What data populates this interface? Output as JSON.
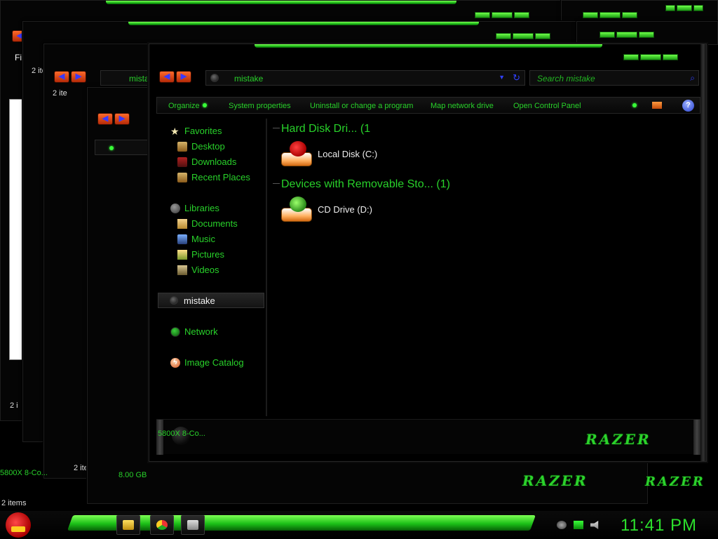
{
  "main_window": {
    "address": "mistake",
    "search_placeholder": "Search mistake",
    "toolbar": {
      "organize": "Organize",
      "system_properties": "System properties",
      "uninstall": "Uninstall or change a program",
      "map_drive": "Map network drive",
      "control_panel": "Open Control Panel"
    },
    "nav": {
      "favorites": "Favorites",
      "desktop": "Desktop",
      "downloads": "Downloads",
      "recent": "Recent Places",
      "libraries": "Libraries",
      "documents": "Documents",
      "music": "Music",
      "pictures": "Pictures",
      "videos": "Videos",
      "computer": "mistake",
      "network": "Network",
      "image_catalog": "Image Catalog"
    },
    "groups": [
      {
        "title": "Hard Disk Dri... (1",
        "items": [
          "Local Disk (C:)"
        ]
      },
      {
        "title": "Devices with Removable Sto... (1)",
        "items": [
          "CD Drive (D:)"
        ]
      }
    ],
    "details": {
      "pc_name": "5800X 8-Co...",
      "brand": "RAZER"
    }
  },
  "background_windows": {
    "address": "mistake",
    "items_count": "2 items",
    "items_count_partial": "2 items",
    "items_partial_short": "2 ite",
    "memory": "8.00 GB",
    "pc_name": "5800X 8-Co...",
    "menu_partial": "Fi",
    "items_clipped": "2 i"
  },
  "taskbar": {
    "clock": "11:41 PM"
  },
  "colors": {
    "accent_green": "#28d12a",
    "glow_green": "#1cc118",
    "nav_orange": "#e24a12"
  }
}
